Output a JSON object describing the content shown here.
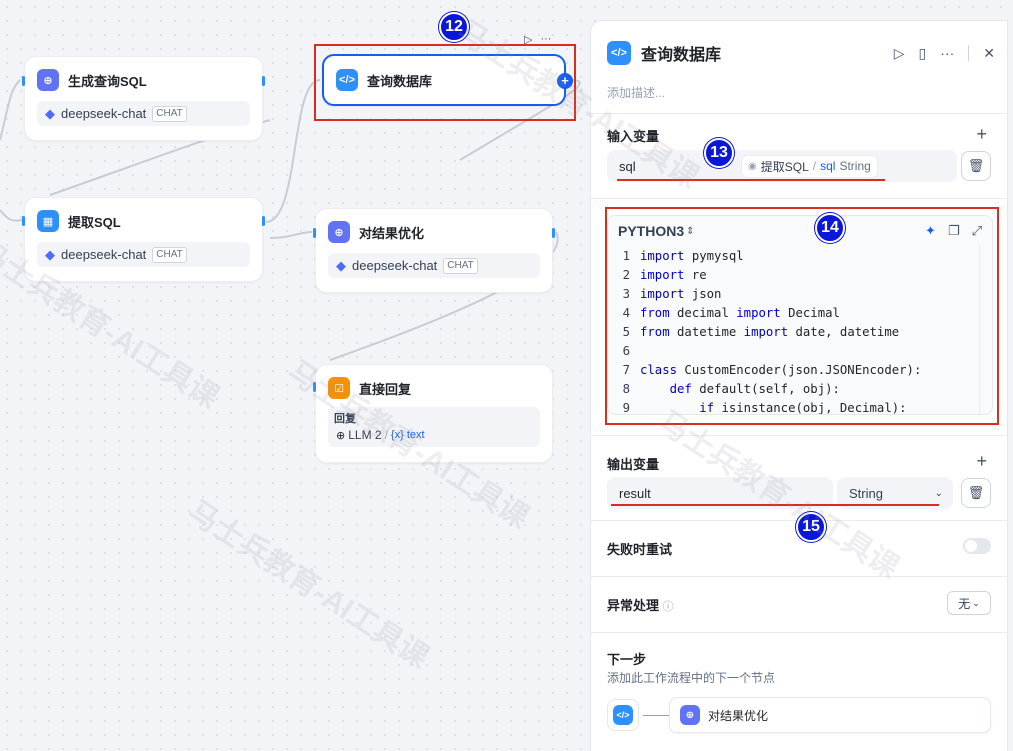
{
  "canvas": {
    "nodes": {
      "gen_sql": {
        "title": "生成查询SQL",
        "icon": "llm-icon",
        "model": "deepseek-chat",
        "mode": "CHAT"
      },
      "extract_sql": {
        "title": "提取SQL",
        "icon": "parameter-extractor-icon",
        "model": "deepseek-chat",
        "mode": "CHAT"
      },
      "query_db": {
        "title": "查询数据库",
        "icon": "code-icon"
      },
      "optimize": {
        "title": "对结果优化",
        "icon": "llm-icon",
        "model": "deepseek-chat",
        "mode": "CHAT"
      },
      "answer": {
        "title": "直接回复",
        "icon": "answer-icon",
        "reply_label": "回复",
        "ref_node": "LLM 2",
        "ref_sep": "/",
        "ref_var": "{x} text"
      }
    },
    "badges": {
      "b12": "12",
      "b13": "13",
      "b14": "14",
      "b15": "15"
    },
    "node_toolbar": {
      "run": "▷",
      "more": "···"
    },
    "watermark": "马士兵教育-AI工具课"
  },
  "panel": {
    "title": "查询数据库",
    "description_placeholder": "添加描述...",
    "input_section": {
      "label": "输入变量",
      "variable": {
        "name": "sql",
        "ref_node": "提取SQL",
        "ref_sep": "/",
        "ref_var": "sql",
        "ref_type": "String"
      }
    },
    "code": {
      "language": "PYTHON3",
      "lines": [
        [
          [
            "kw",
            "import"
          ],
          [
            "",
            " pymysql"
          ]
        ],
        [
          [
            "kw",
            "import"
          ],
          [
            "",
            " re"
          ]
        ],
        [
          [
            "kw",
            "import"
          ],
          [
            "",
            " json"
          ]
        ],
        [
          [
            "kw",
            "from"
          ],
          [
            "",
            " decimal "
          ],
          [
            "kw",
            "import"
          ],
          [
            "",
            " Decimal"
          ]
        ],
        [
          [
            "kw",
            "from"
          ],
          [
            "",
            " datetime "
          ],
          [
            "kw",
            "import"
          ],
          [
            "",
            " date, datetime"
          ]
        ],
        [
          [
            "",
            ""
          ]
        ],
        [
          [
            "kw",
            "class"
          ],
          [
            "",
            " CustomEncoder(json.JSONEncoder):"
          ]
        ],
        [
          [
            "",
            "    "
          ],
          [
            "kw",
            "def"
          ],
          [
            "",
            " default(self, obj):"
          ]
        ],
        [
          [
            "",
            "        "
          ],
          [
            "kw",
            "if"
          ],
          [
            "",
            " isinstance(obj, Decimal):"
          ]
        ]
      ]
    },
    "output_section": {
      "label": "输出变量",
      "variable": {
        "name": "result",
        "type": "String"
      }
    },
    "retry": {
      "label": "失败时重试",
      "enabled": false
    },
    "error_handling": {
      "label": "异常处理",
      "value": "无"
    },
    "next_step": {
      "label": "下一步",
      "hint": "添加此工作流程中的下一个节点",
      "node": "对结果优化"
    }
  },
  "colors": {
    "accent": "#155eef",
    "annotation_red": "#d92d20",
    "badge_blue": "#0a16d8"
  }
}
